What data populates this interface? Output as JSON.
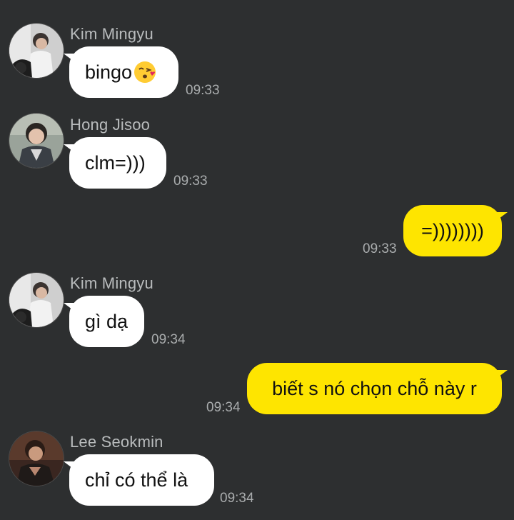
{
  "messages": [
    {
      "sender": "Kim Mingyu",
      "text": "bingo",
      "emoji": "kissing-face-emoji",
      "time": "09:33",
      "direction": "in"
    },
    {
      "sender": "Hong Jisoo",
      "text": "clm=)))",
      "time": "09:33",
      "direction": "in"
    },
    {
      "text": "=))))))))",
      "time": "09:33",
      "direction": "out"
    },
    {
      "sender": "Kim Mingyu",
      "text": "gì dạ",
      "time": "09:34",
      "direction": "in"
    },
    {
      "text": "biết s nó chọn chỗ này r",
      "time": "09:34",
      "direction": "out"
    },
    {
      "sender": "Lee Seokmin",
      "text": "chỉ có thể là",
      "time": "09:34",
      "direction": "in"
    }
  ],
  "colors": {
    "background": "#2d2f30",
    "incoming_bubble": "#ffffff",
    "outgoing_bubble": "#fee500",
    "sender_name": "#b9bcbd",
    "timestamp": "#a9acad"
  }
}
